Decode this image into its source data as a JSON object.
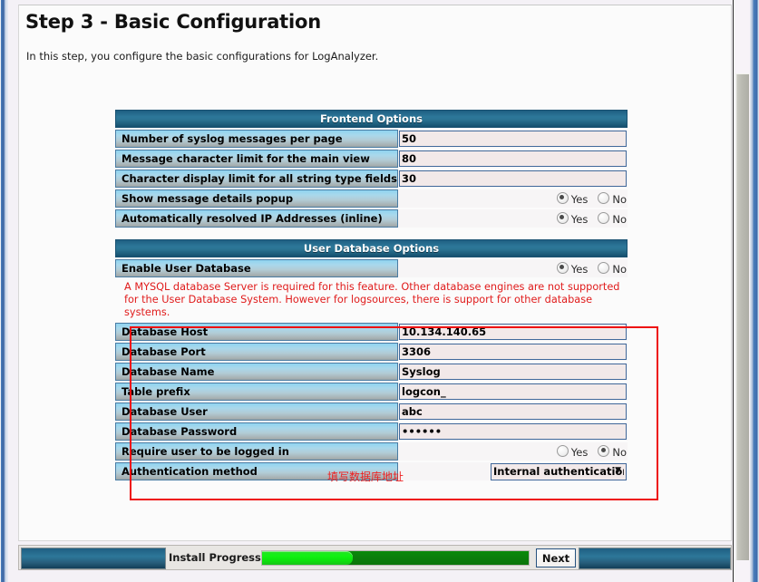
{
  "page": {
    "title": "Step 3 - Basic Configuration",
    "subtitle": "In this step, you configure the basic configurations for LogAnalyzer."
  },
  "sections": {
    "frontend": {
      "header": "Frontend Options",
      "rows": [
        {
          "label": "Number of syslog messages per page",
          "type": "text",
          "value": "50"
        },
        {
          "label": "Message character limit for the main view",
          "type": "text",
          "value": "80"
        },
        {
          "label": "Character display limit for all string type fields",
          "type": "text",
          "value": "30"
        },
        {
          "label": "Show message details popup",
          "type": "radio",
          "selected": "Yes"
        },
        {
          "label": "Automatically resolved IP Addresses (inline)",
          "type": "radio",
          "selected": "Yes"
        }
      ]
    },
    "userdb": {
      "header": "User Database Options",
      "enable_row": {
        "label": "Enable User Database",
        "type": "radio",
        "selected": "Yes"
      },
      "warning": "A MYSQL database Server is required for this feature. Other database engines are not supported for the User Database System. However for logsources, there is support for other database systems.",
      "rows": [
        {
          "label": "Database Host",
          "type": "text",
          "value": "10.134.140.65"
        },
        {
          "label": "Database Port",
          "type": "text",
          "value": "3306"
        },
        {
          "label": "Database Name",
          "type": "text",
          "value": "Syslog"
        },
        {
          "label": "Table prefix",
          "type": "text",
          "value": "logcon_"
        },
        {
          "label": "Database User",
          "type": "text",
          "value": "abc"
        },
        {
          "label": "Database Password",
          "type": "password",
          "value": "••••••"
        },
        {
          "label": "Require user to be logged in",
          "type": "radio",
          "selected": "No"
        },
        {
          "label": "Authentication method",
          "type": "select",
          "value": "Internal authentication",
          "options": [
            "Internal authentication"
          ]
        }
      ]
    }
  },
  "radio_labels": {
    "yes": "Yes",
    "no": "No"
  },
  "annotation": {
    "note_text": "填写数据库地址",
    "box_color": "#ee1111"
  },
  "footer": {
    "progress_label": "Install Progress:",
    "progress_percent": 34,
    "next_label": "Next",
    "bar_fill_color": "#12f112",
    "bar_track_color": "#0b800b"
  }
}
